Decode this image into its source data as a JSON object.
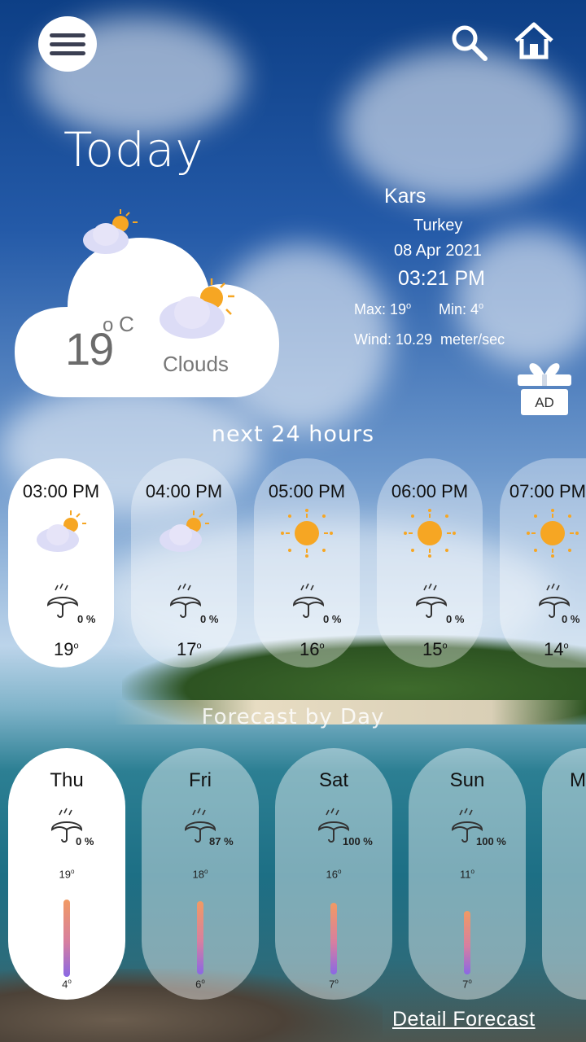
{
  "header": {
    "title": "Today"
  },
  "icons": {
    "menu": "hamburger-menu-icon",
    "search": "search-icon",
    "home": "home-icon",
    "ad": "gift-icon"
  },
  "location": {
    "city": "Kars",
    "country": "Turkey",
    "date": "08 Apr 2021",
    "time": "03:21 PM",
    "max_label": "Max: 19",
    "min_label": "Min: 4",
    "wind": "Wind: 10.29  meter/sec"
  },
  "current": {
    "temp": "19",
    "deg_o": "o",
    "deg_c": "C",
    "condition": "Clouds"
  },
  "ad_label": "AD",
  "hourly_title": "next 24 hours",
  "hourly": [
    {
      "time": "03:00 PM",
      "icon": "cloud-sun",
      "rain": "0 %",
      "temp": "19"
    },
    {
      "time": "04:00 PM",
      "icon": "cloud-sun",
      "rain": "0 %",
      "temp": "17"
    },
    {
      "time": "05:00 PM",
      "icon": "sun",
      "rain": "0 %",
      "temp": "16"
    },
    {
      "time": "06:00 PM",
      "icon": "sun",
      "rain": "0 %",
      "temp": "15"
    },
    {
      "time": "07:00 PM",
      "icon": "sun",
      "rain": "0 %",
      "temp": "14"
    }
  ],
  "daily_title": "Forecast by Day",
  "daily": [
    {
      "day": "Thu",
      "rain": "0 %",
      "hi": "19",
      "lo": "4"
    },
    {
      "day": "Fri",
      "rain": "87 %",
      "hi": "18",
      "lo": "6"
    },
    {
      "day": "Sat",
      "rain": "100 %",
      "hi": "16",
      "lo": "7"
    },
    {
      "day": "Sun",
      "rain": "100 %",
      "hi": "11",
      "lo": "7"
    },
    {
      "day": "M",
      "rain": "",
      "hi": "",
      "lo": ""
    }
  ],
  "detail_link": "Detail Forecast",
  "colors": {
    "sun": "#f6a623",
    "cloud": "#dcdcf6",
    "accent": "#ffffff"
  }
}
